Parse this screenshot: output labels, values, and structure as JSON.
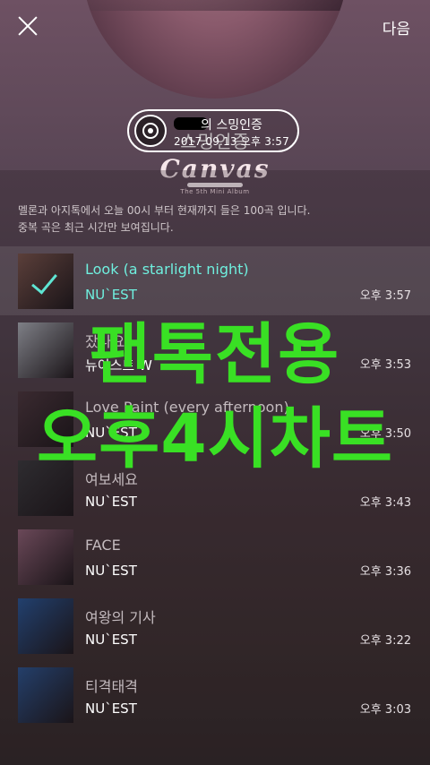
{
  "header": {
    "album_title": "스밍인증",
    "album_logo": "Canvas",
    "album_subtitle": "The 5th Mini Album",
    "next_label": "다음"
  },
  "badge": {
    "title_suffix": "의 스밍인증",
    "timestamp": "2017.09.13 오후 3:57"
  },
  "info": {
    "line1": "멜론과 아지톡에서 오늘 00시 부터 현재까지 들은 100곡 입니다.",
    "line2": "중복 곡은 최근 시간만 보여집니다."
  },
  "tracks": [
    {
      "title": "Look (a starlight night)",
      "artist": "NU`EST",
      "time": "오후 3:57",
      "active": true,
      "art": "#5b3f3a"
    },
    {
      "title": "잤나요",
      "artist": "뉴이스트 W",
      "time": "오후 3:53",
      "active": false,
      "art": "#7e7f86"
    },
    {
      "title": "Love Paint (every afternoon)",
      "artist": "NU`EST",
      "time": "오후 3:50",
      "active": false,
      "art": "#3a2a30"
    },
    {
      "title": "여보세요",
      "artist": "NU`EST",
      "time": "오후 3:43",
      "active": false,
      "art": "#2e2c30"
    },
    {
      "title": "FACE",
      "artist": "NU`EST",
      "time": "오후 3:36",
      "active": false,
      "art": "#6a4858"
    },
    {
      "title": "여왕의 기사",
      "artist": "NU`EST",
      "time": "오후 3:22",
      "active": false,
      "art": "#22406e"
    },
    {
      "title": "티격태격",
      "artist": "NU`EST",
      "time": "오후 3:03",
      "active": false,
      "art": "#243f6a"
    }
  ],
  "overlay": {
    "line1": "팬톡전용",
    "line2": "오후4시차트",
    "color": "#39e024"
  },
  "accent_color": "#6ff0df"
}
